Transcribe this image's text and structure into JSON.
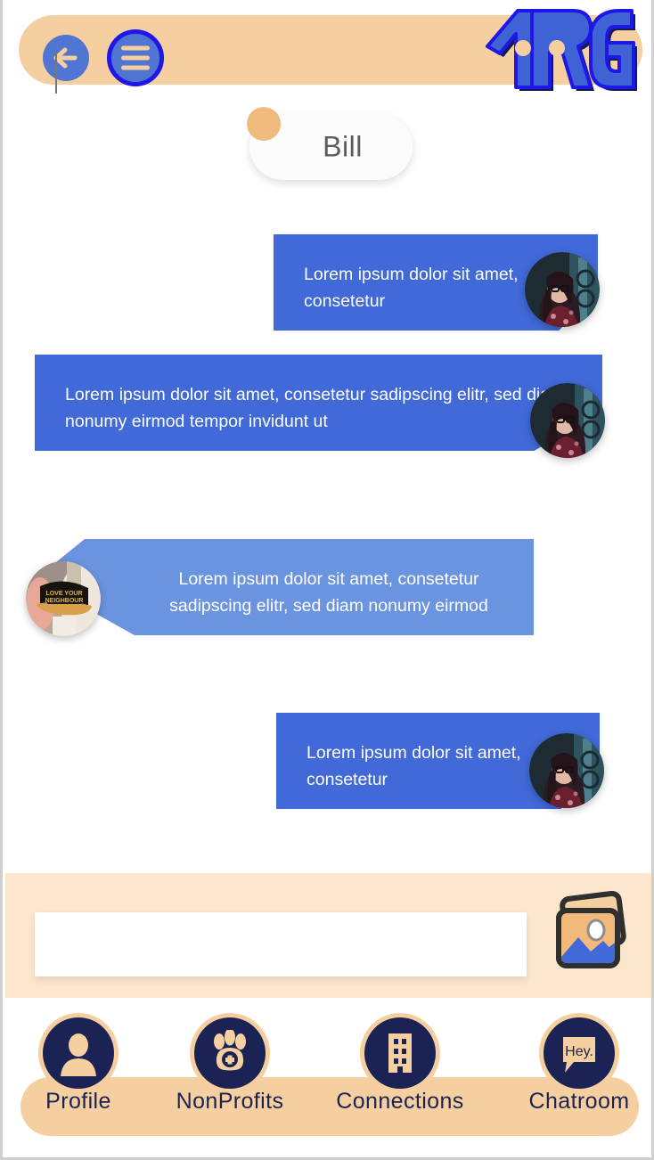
{
  "app": {
    "accent_peach": "#f6cfa0",
    "accent_peach_light": "#fce7ce",
    "accent_blue": "#4169d8",
    "accent_blue_light": "#6b94e0",
    "accent_navy": "#1a2353",
    "logo_text": "TRG"
  },
  "header": {
    "back_label": "Back",
    "menu_label": "Menu",
    "logo_alt": "TRG"
  },
  "conversation": {
    "contact_name": "Bill"
  },
  "messages": [
    {
      "id": "msg-1",
      "side": "right",
      "text": "Lorem ipsum dolor sit amet, consetetur",
      "avatar": "woman-with-glasses-photo"
    },
    {
      "id": "msg-2",
      "side": "right",
      "text": "Lorem ipsum dolor sit amet, consetetur sadipscing elitr, sed diam nonumy eirmod tempor invidunt ut",
      "avatar": "woman-with-glasses-photo"
    },
    {
      "id": "msg-3",
      "side": "left",
      "text": "Lorem ipsum dolor sit amet, consetetur sadipscing elitr, sed diam nonumy eirmod",
      "avatar": "love-your-neighbour-cap-photo"
    },
    {
      "id": "msg-4",
      "side": "right",
      "text": "Lorem ipsum dolor sit amet, consetetur",
      "avatar": "woman-with-glasses-photo"
    }
  ],
  "composer": {
    "value": "",
    "placeholder": "",
    "attach_image_label": "Add photo"
  },
  "bottom_nav": {
    "items": [
      {
        "label": "Profile",
        "icon": "person-icon"
      },
      {
        "label": "NonProfits",
        "icon": "paw-medical-icon"
      },
      {
        "label": "Connections",
        "icon": "building-icon"
      },
      {
        "label": "Chatroom",
        "icon": "speech-bubble-icon",
        "icon_text": "Hey."
      }
    ]
  }
}
